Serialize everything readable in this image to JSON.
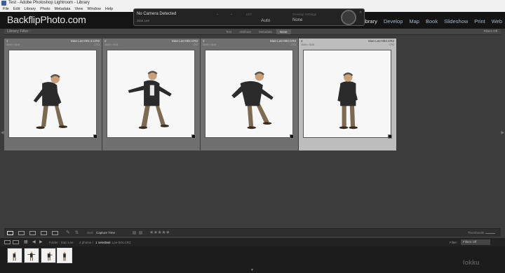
{
  "window": {
    "title": "Test - Adobe Photoshop Lightroom - Library",
    "menu": [
      "File",
      "Edit",
      "Library",
      "Photo",
      "Metadata",
      "View",
      "Window",
      "Help"
    ]
  },
  "identity_plate": "BackflipPhoto.com",
  "modules": [
    "Library",
    "Develop",
    "Map",
    "Book",
    "Slideshow",
    "Print",
    "Web"
  ],
  "tether": {
    "status": "No Camera Detected",
    "session": "Stan Lee",
    "iso_label": "ISO",
    "wb_value": "Auto",
    "develop_label": "Develop Settings",
    "develop_value": "None"
  },
  "library_filter": {
    "label": "Library Filter :",
    "options": [
      "Text",
      "Attribute",
      "Metadata",
      "None"
    ],
    "selected": "None",
    "preset": "Filters Off"
  },
  "photos": [
    {
      "num": "1",
      "name": "Stan Lee-001-2.CR2",
      "dims": "3648 x 3648",
      "ext": "CR2"
    },
    {
      "num": "2",
      "name": "Stan Lee-002.CR2",
      "dims": "3648 x 3648",
      "ext": "CR2"
    },
    {
      "num": "3",
      "name": "Stan Lee-003.CR2",
      "dims": "3648 x 3648",
      "ext": "CR2"
    },
    {
      "num": "4",
      "name": "Stan Lee-004.CR2",
      "dims": "3648 x 3648",
      "ext": "CR2"
    }
  ],
  "selected_photo": 4,
  "toolbar": {
    "sort_label": "Sort:",
    "sort_value": "Capture Time",
    "rating": 0,
    "thumbnails_label": "Thumbnails"
  },
  "filmstrip": {
    "path": "Folder : Stan Lee",
    "count": "4 photos /",
    "selected": "1 selected",
    "file": "/Stan Lee-004.CR2",
    "filter_label": "Filter :",
    "filter_value": "Filters Off"
  },
  "watermark": "lokku"
}
